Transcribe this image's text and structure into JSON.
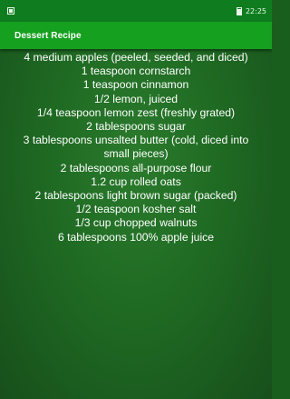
{
  "status_bar": {
    "time": "22:25",
    "notification_icon": "notification-icon",
    "battery_icon": "battery-icon"
  },
  "app_bar": {
    "title": "Dessert Recipe"
  },
  "recipe": {
    "ingredients": [
      "4 medium apples (peeled, seeded, and diced)",
      "1 teaspoon cornstarch",
      "1 teaspoon cinnamon",
      "1/2 lemon, juiced",
      "1/4 teaspoon lemon zest (freshly grated)",
      "2 tablespoons sugar",
      "3 tablespoons unsalted butter (cold, diced into small pieces)",
      "2 tablespoons all-purpose flour",
      "1.2 cup rolled oats",
      "2 tablespoons light brown sugar (packed)",
      "1/2 teaspoon kosher salt",
      "1/3 cup chopped walnuts",
      "6 tablespoons 100% apple juice"
    ]
  },
  "colors": {
    "status_bar": "#0f7d1f",
    "app_bar": "#16a020",
    "background": "#1f6a23",
    "text": "#ffffff"
  }
}
